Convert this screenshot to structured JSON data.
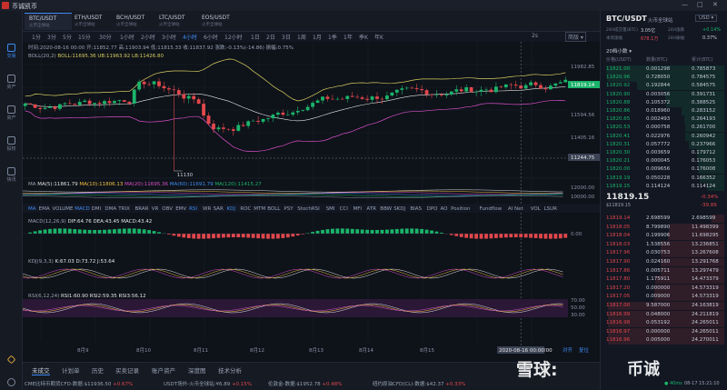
{
  "titlebar": {
    "title": "币诚凯币",
    "min": "—",
    "max": "□",
    "close": "✕"
  },
  "sidebar": [
    {
      "label": "交易",
      "icon": "candlestick-icon"
    },
    {
      "label": "资产",
      "icon": "wallet-icon"
    },
    {
      "label": "资产",
      "icon": "coin-icon"
    },
    {
      "label": "投权",
      "icon": "chart-icon"
    },
    {
      "label": "快讯",
      "icon": "news-icon"
    }
  ],
  "pair_tabs": [
    {
      "name": "BTC/USDT",
      "sub": "火币全球站",
      "active": true
    },
    {
      "name": "ETH/USDT",
      "sub": "火币全球站",
      "active": false
    },
    {
      "name": "BCH/USDT",
      "sub": "火币全球站",
      "active": false
    },
    {
      "name": "LTC/USDT",
      "sub": "火币全球站",
      "active": false
    },
    {
      "name": "EOS/USDT",
      "sub": "火币全球站",
      "active": false
    }
  ],
  "timeframes": [
    "1分",
    "3分",
    "5分",
    "15分",
    "30分",
    "1小时",
    "2小时",
    "3小时",
    "4小时",
    "6小时",
    "12小时",
    "1日",
    "2日",
    "3日",
    "1周",
    "1月",
    "1季",
    "1年",
    "季K",
    "年K"
  ],
  "active_timeframe": "4小时",
  "tf_controls": {
    "scale": "2s",
    "view": "简版"
  },
  "chart_info": {
    "ohlc": "时间:2020-08-16 00:00 开:11852.77 高:11903.94 低:11815.33 收:11837.92 涨跌:-0.13%(-14.86) 振幅:0.75%",
    "boll_label": "BOLL(20,2)",
    "boll_values": "BOLL:11695.36 UB:11963.92 LB:11426.80",
    "ma_label": "MA",
    "ma_values": [
      {
        "text": "MA(5):11861.79",
        "color": "#e0e0e0"
      },
      {
        "text": "MA(10):11806.13",
        "color": "#f0c040"
      },
      {
        "text": "MA(20):11695.36",
        "color": "#d850c8"
      },
      {
        "text": "MA(60):11691.79",
        "color": "#3e8cf0"
      },
      {
        "text": "MA(120):11415.27",
        "color": "#1bb46b"
      }
    ],
    "macd_label": "MACD(12,26,9)",
    "macd_values": "DIF:64.76 DEA:43.45 MACD:43.42",
    "kdj_label": "KDJ(9,3,3)",
    "kdj_values": "K:67.03 D:73.72 J:53.64",
    "rsi_label": "RSI(6,12,24)",
    "rsi_values": "RSI1:60.90 RSI2:59.35 RSI3:56.12",
    "low_marker": "11130"
  },
  "indicator_tabs": [
    "MA",
    "EMA",
    "VOLUME",
    "MACD",
    "DMI",
    "DMA",
    "TRIX",
    "BRAR",
    "VR",
    "OBV",
    "EMV",
    "RSI",
    "WR",
    "SAR",
    "KDJ",
    "ROC",
    "MTM",
    "BOLL",
    "PSY",
    "StochRSI",
    "SMI",
    "CCI",
    "MFI",
    "ATR",
    "BBW",
    "SKDJ",
    "BIAS",
    "DPO",
    "AO",
    "Position",
    "Fundflow",
    "AI Net",
    "VOL",
    "LSUR"
  ],
  "price_axis": [
    "11982.85",
    "11819.14",
    "11594.56",
    "11405.16",
    "11244.75"
  ],
  "volume_axis": [
    "12000.00",
    "10000.00"
  ],
  "macd_axis": [
    "0.00"
  ],
  "rsi_axis": [
    "70.00",
    "50.00",
    "30.00"
  ],
  "current_price_label": "11819.14",
  "crosshair_price": "11244.75",
  "date_axis": [
    "8月9",
    "8月10",
    "8月11",
    "8月12",
    "8月13",
    "8月14",
    "8月15",
    "8月17"
  ],
  "crosshair_date": "2020-08-16 00:00:00",
  "date_controls": [
    "对齐",
    "复位"
  ],
  "right_panel": {
    "pair": "BTC/USDT",
    "exchange": "火币全球站",
    "currency": "USD",
    "stats": [
      {
        "label": "24H成交量(BTC)",
        "value": "3.05亿"
      },
      {
        "label": "24H涨跌",
        "value": "+0.14%"
      },
      {
        "label": "本周涨幅",
        "value": "678.1万"
      },
      {
        "label": "24H振幅",
        "value": "0.37%"
      }
    ],
    "depth_label": "20档小数",
    "headers": [
      "价格(USDT)",
      "数量(BTC)",
      "累计(BTC)"
    ],
    "asks": [
      [
        "11821.00",
        "0.001298",
        "0.785873"
      ],
      [
        "11820.96",
        "0.728050",
        "0.784575"
      ],
      [
        "11820.92",
        "0.192844",
        "0.584575"
      ],
      [
        "11820.90",
        "0.003056",
        "0.391731"
      ],
      [
        "11820.88",
        "0.105372",
        "0.388525"
      ],
      [
        "11820.86",
        "0.018960",
        "0.283152"
      ],
      [
        "11820.65",
        "0.002493",
        "0.264193"
      ],
      [
        "11820.53",
        "0.000758",
        "0.261700"
      ],
      [
        "11820.41",
        "0.022976",
        "0.260942"
      ],
      [
        "11820.31",
        "0.057772",
        "0.237966"
      ],
      [
        "11820.30",
        "0.003659",
        "0.179712"
      ],
      [
        "11820.21",
        "0.000045",
        "0.176053"
      ],
      [
        "11820.00",
        "0.009656",
        "0.176008"
      ],
      [
        "11819.19",
        "0.050228",
        "0.166352"
      ],
      [
        "11819.15",
        "0.114124",
        "0.114124"
      ]
    ],
    "last_price": "11819.15",
    "last_sub": "$11819.15",
    "last_change": "-0.34%",
    "last_change2": "-39.89",
    "bids": [
      [
        "11819.14",
        "2.698599",
        "2.698599"
      ],
      [
        "11818.05",
        "8.799890",
        "11.498399"
      ],
      [
        "11818.04",
        "0.199906",
        "11.698295"
      ],
      [
        "11818.03",
        "1.538556",
        "13.236851"
      ],
      [
        "11817.96",
        "0.030753",
        "13.267608"
      ],
      [
        "11817.90",
        "0.024160",
        "13.291768"
      ],
      [
        "11817.86",
        "0.005711",
        "13.297479"
      ],
      [
        "11817.80",
        "1.175911",
        "14.473379"
      ],
      [
        "11817.20",
        "0.000000",
        "14.573319"
      ],
      [
        "11817.05",
        "0.009000",
        "14.573319"
      ],
      [
        "11817.00",
        "9.587000",
        "24.163819"
      ],
      [
        "11816.99",
        "0.048000",
        "24.211819"
      ],
      [
        "11816.98",
        "0.053192",
        "24.265011"
      ],
      [
        "11816.97",
        "0.000000",
        "24.265011"
      ],
      [
        "11816.96",
        "0.005000",
        "24.270011"
      ]
    ]
  },
  "bottom_tabs": [
    "未成交",
    "计划单",
    "历史",
    "买卖记录",
    "账户资产",
    "深度图",
    "技术分析"
  ],
  "tickers": [
    {
      "label": "CME比特币期货CFD-数据:",
      "value": "$11936.50",
      "chg": "+0.67%"
    },
    {
      "label": "USDT场外-火币全球站:",
      "value": "¥6.89",
      "chg": "+0.15%"
    },
    {
      "label": "伦敦金-数据:",
      "value": "$1952.78",
      "chg": "+0.48%"
    },
    {
      "label": "纽约原油CFD(CL)-数据:",
      "value": "$42.37",
      "chg": "+0.33%"
    }
  ],
  "status": {
    "signal": "40ms",
    "time": "08-17 15:21:10"
  },
  "watermark": {
    "brand": "雪球:",
    "user": "币诚"
  }
}
